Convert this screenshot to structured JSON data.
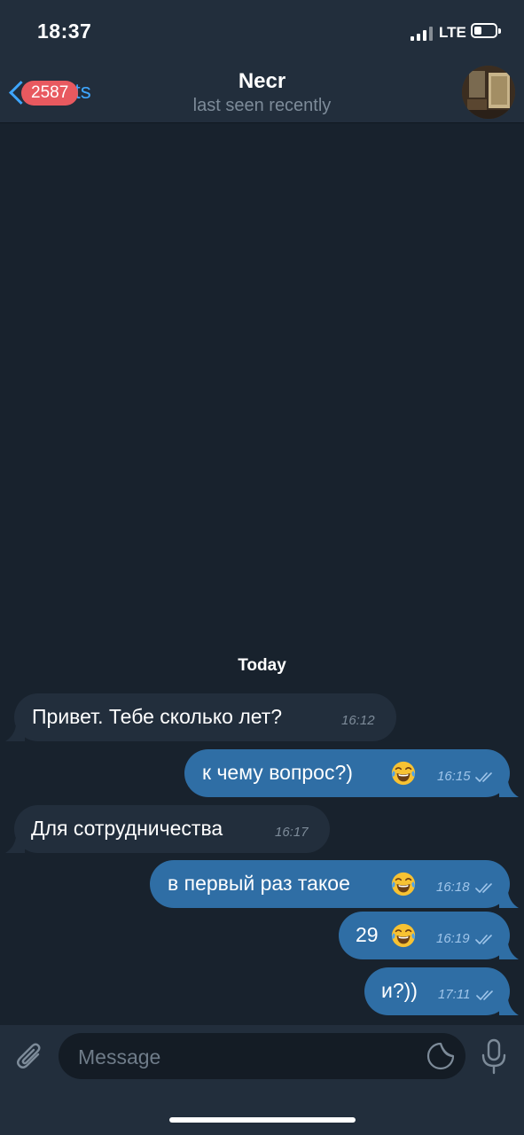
{
  "status": {
    "time": "18:37",
    "network": "LTE"
  },
  "header": {
    "back_label": "Chats",
    "unread_badge": "2587",
    "contact_name": "Necr",
    "contact_status": "last seen recently"
  },
  "date_separator": "Today",
  "messages": [
    {
      "direction": "incoming",
      "text": "Привет. Тебе сколько лет?",
      "time": "16:12"
    },
    {
      "direction": "outgoing",
      "text": "к чему вопрос?)",
      "emoji": "face-with-tears-of-joy",
      "time": "16:15",
      "status": "read"
    },
    {
      "direction": "incoming",
      "text": "Для сотрудничества",
      "time": "16:17"
    },
    {
      "direction": "outgoing",
      "text": "в первый раз такое",
      "emoji": "face-with-tears-of-joy",
      "time": "16:18",
      "status": "read"
    },
    {
      "direction": "outgoing",
      "text": "29",
      "emoji": "face-with-tears-of-joy",
      "time": "16:19",
      "status": "read"
    },
    {
      "direction": "outgoing",
      "text": "и?))",
      "time": "17:11",
      "status": "read"
    }
  ],
  "composer": {
    "placeholder": "Message"
  },
  "colors": {
    "background": "#18222d",
    "bar": "#222e3c",
    "incoming_bubble": "#222e3c",
    "outgoing_bubble": "#2f6ea5",
    "accent": "#3ea6ff",
    "badge": "#e8595f"
  },
  "icons": [
    "back-chevron-icon",
    "avatar-photo",
    "read-ticks-icon",
    "tears-of-joy-emoji",
    "paperclip-icon",
    "sticker-icon",
    "microphone-icon"
  ]
}
